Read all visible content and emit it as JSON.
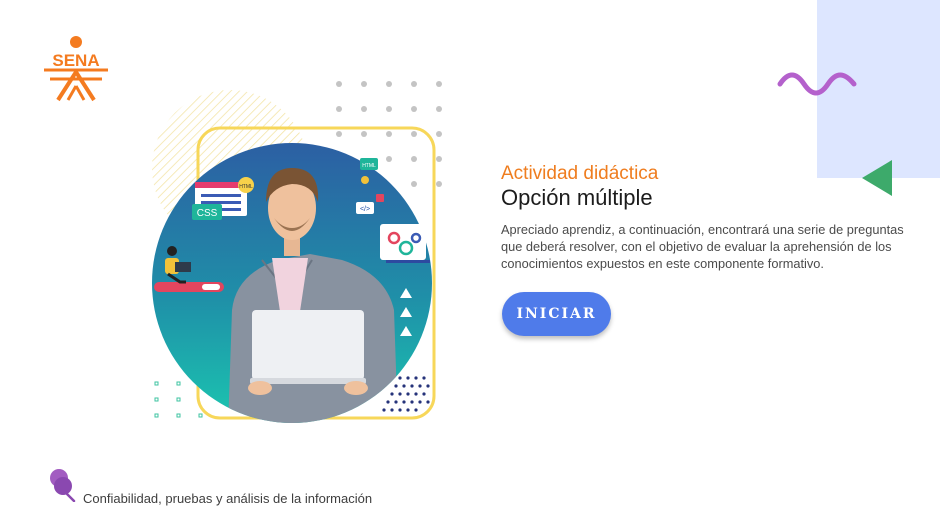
{
  "logo": {
    "text": "SENA",
    "color": "#f47b20"
  },
  "activity": {
    "subtitle": "Actividad didáctica",
    "title": "Opción múltiple",
    "description": "Apreciado aprendiz, a continuación, encontrará una serie de preguntas que deberá resolver, con el objetivo de evaluar la aprehensión de los conocimientos expuestos en este componente formativo."
  },
  "start_button": {
    "label": "INICIAR",
    "color": "#4f7bea"
  },
  "illustration": {
    "tags": {
      "css": "CSS",
      "html": "HTML",
      "html_small": "HTML",
      "code": "</>"
    }
  },
  "footer": {
    "text": "Confiabilidad, pruebas y análisis de la información",
    "icon": "pin-icon"
  },
  "colors": {
    "accent_orange": "#ef7d1f",
    "panel_blue": "#dde6ff",
    "wave_purple": "#b461cc",
    "triangle_green": "#3daa6b"
  }
}
